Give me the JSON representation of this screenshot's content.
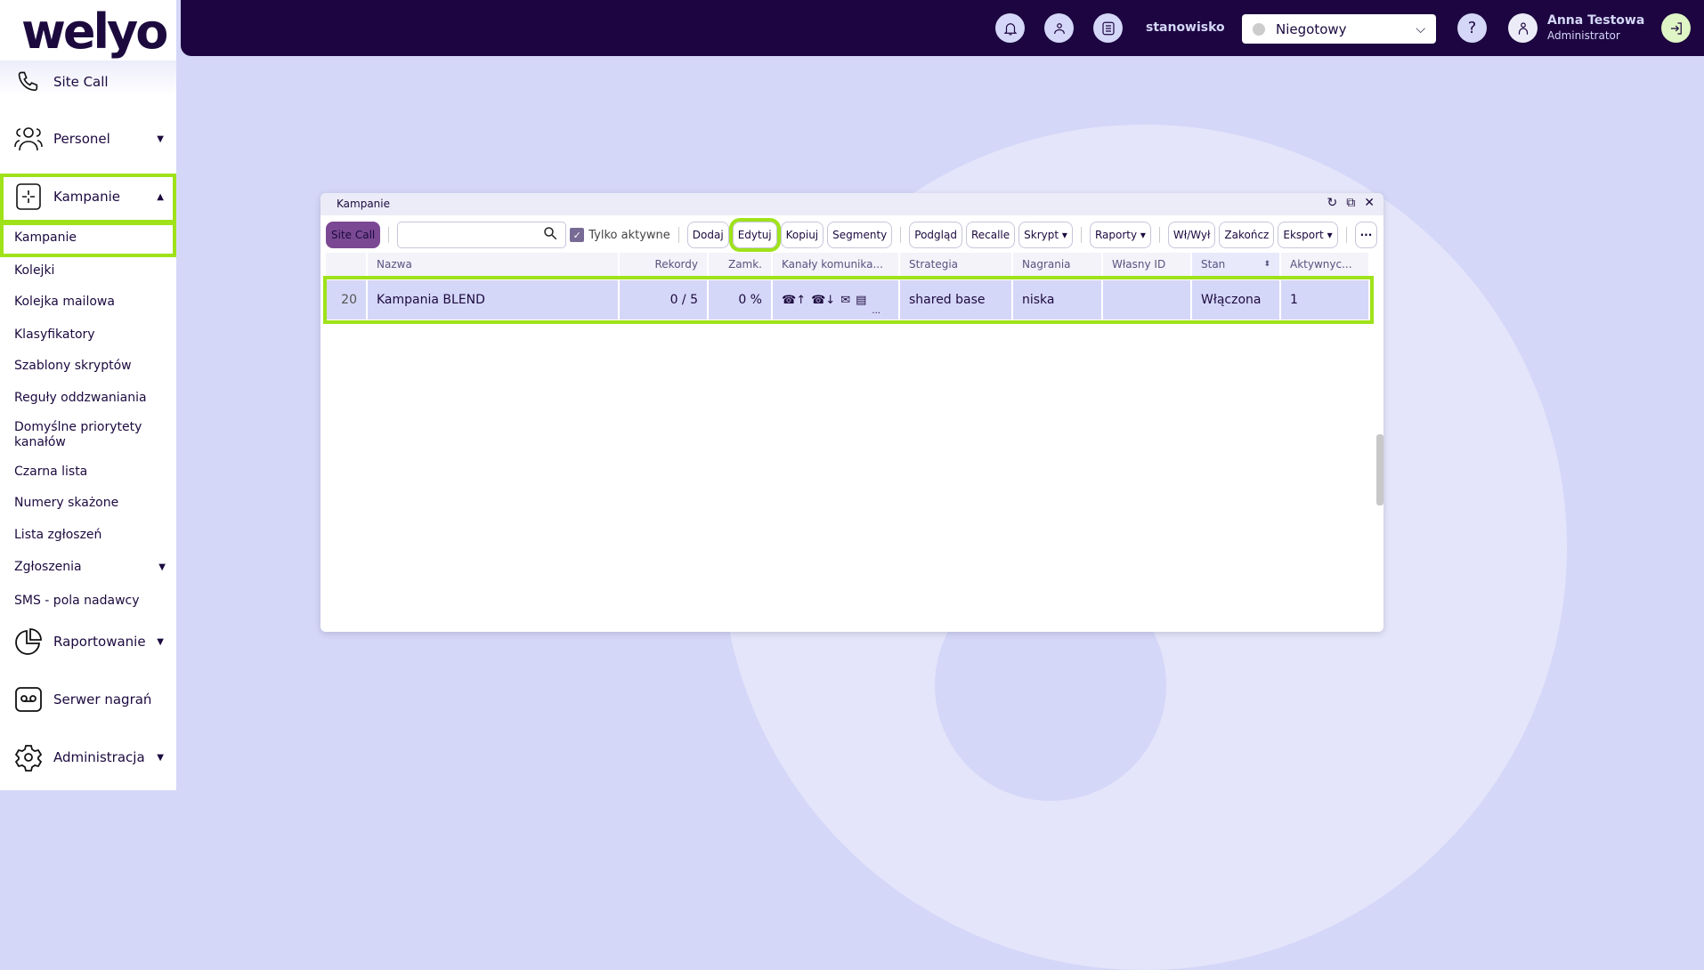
{
  "brand": {
    "logo": "welyo"
  },
  "sidebar": {
    "items": [
      {
        "label": "Site Call",
        "icon": "phone-icon"
      },
      {
        "label": "Personel",
        "icon": "users-icon",
        "caret": "▼"
      },
      {
        "label": "Kampanie",
        "icon": "campaign-icon",
        "caret": "▲"
      }
    ],
    "sub_items": [
      "Kampanie",
      "Kolejki",
      "Kolejka mailowa",
      "Klasyfikatory",
      "Szablony skryptów",
      "Reguły oddzwaniania",
      "Domyślne priorytety kanałów",
      "Czarna lista",
      "Numery skażone",
      "Lista zgłoszeń",
      "Zgłoszenia",
      "SMS - pola nadawcy"
    ],
    "bottom_items": [
      {
        "label": "Raportowanie",
        "icon": "pie-chart-icon"
      },
      {
        "label": "Serwer nagrań",
        "icon": "voicemail-icon"
      },
      {
        "label": "Administracja",
        "icon": "gear-icon"
      }
    ]
  },
  "topbar": {
    "workstation": "stanowisko",
    "status": "Niegotowy",
    "help": "?",
    "user_name": "Anna Testowa",
    "user_role": "Administrator"
  },
  "dialog": {
    "title": "Kampanie",
    "toolbar": {
      "site_call": "Site Call",
      "search_value": "",
      "only_active": "Tylko aktywne",
      "add": "Dodaj",
      "edit": "Edytuj",
      "copy": "Kopiuj",
      "segments": "Segmenty",
      "preview": "Podgląd",
      "recalls": "Recalle",
      "script": "Skrypt",
      "reports": "Raporty",
      "toggle": "Wł/Wył",
      "finish": "Zakończ",
      "export": "Eksport",
      "more": "···"
    },
    "columns": [
      "",
      "Nazwa",
      "Rekordy",
      "Zamk.",
      "Kanały komunika...",
      "Strategia",
      "Nagrania",
      "Własny ID",
      "Stan",
      "Aktywnyc..."
    ],
    "rows": [
      {
        "id": "20",
        "name": "Kampania BLEND",
        "records": "0 / 5",
        "closed": "0 %",
        "channels_more": "...",
        "strategy": "shared base",
        "recordings": "niska",
        "custom_id": "",
        "state": "Włączona",
        "active": "1"
      }
    ]
  },
  "colors": {
    "highlight": "#9fe21a",
    "topbar": "#1c0540",
    "accent": "#7b4993"
  }
}
